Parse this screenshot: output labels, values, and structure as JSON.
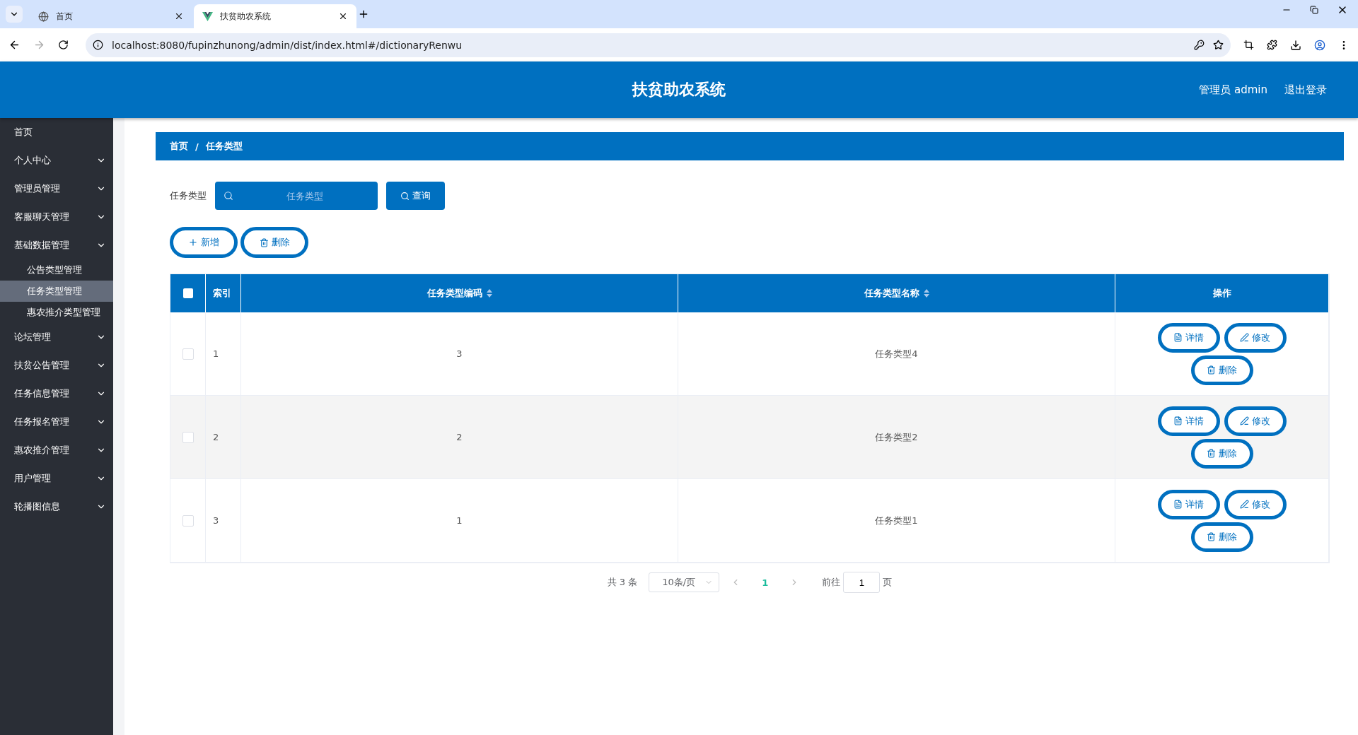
{
  "browser": {
    "tabs": [
      {
        "title": "首页",
        "selected": false
      },
      {
        "title": "扶贫助农系统",
        "selected": true
      }
    ],
    "url": "localhost:8080/fupinzhunong/admin/dist/index.html#/dictionaryRenwu"
  },
  "header": {
    "title": "扶贫助农系统",
    "user": "管理员 admin",
    "logout": "退出登录"
  },
  "sidebar": {
    "items": [
      {
        "label": "首页",
        "expandable": false,
        "selected": false
      },
      {
        "label": "个人中心",
        "expandable": true,
        "selected": false
      },
      {
        "label": "管理员管理",
        "expandable": true,
        "selected": false
      },
      {
        "label": "客服聊天管理",
        "expandable": true,
        "selected": false
      },
      {
        "label": "基础数据管理",
        "expandable": true,
        "selected": false,
        "children": [
          {
            "label": "公告类型管理",
            "selected": false
          },
          {
            "label": "任务类型管理",
            "selected": true
          },
          {
            "label": "惠农推介类型管理",
            "selected": false
          }
        ]
      },
      {
        "label": "论坛管理",
        "expandable": true,
        "selected": false
      },
      {
        "label": "扶贫公告管理",
        "expandable": true,
        "selected": false
      },
      {
        "label": "任务信息管理",
        "expandable": true,
        "selected": false
      },
      {
        "label": "任务报名管理",
        "expandable": true,
        "selected": false
      },
      {
        "label": "惠农推介管理",
        "expandable": true,
        "selected": false
      },
      {
        "label": "用户管理",
        "expandable": true,
        "selected": false
      },
      {
        "label": "轮播图信息",
        "expandable": true,
        "selected": false
      }
    ]
  },
  "breadcrumb": {
    "items": [
      "首页",
      "任务类型"
    ],
    "separator": "/"
  },
  "search": {
    "label": "任务类型",
    "placeholder": "任务类型",
    "button": "查询"
  },
  "actions": [
    "新增",
    "删除"
  ],
  "table": {
    "columns": [
      {
        "label": "索引",
        "sortable": false
      },
      {
        "label": "任务类型编码",
        "sortable": true
      },
      {
        "label": "任务类型名称",
        "sortable": true
      },
      {
        "label": "操作",
        "sortable": false
      }
    ],
    "select_all_checked": false,
    "rows": [
      {
        "index": "1",
        "code": "3",
        "name": "任务类型4",
        "checked": false,
        "actions": [
          "详情",
          "修改",
          "删除"
        ]
      },
      {
        "index": "2",
        "code": "2",
        "name": "任务类型2",
        "checked": false,
        "actions": [
          "详情",
          "修改",
          "删除"
        ]
      },
      {
        "index": "3",
        "code": "1",
        "name": "任务类型1",
        "checked": false,
        "actions": [
          "详情",
          "修改",
          "删除"
        ]
      }
    ]
  },
  "pagination": {
    "total": "共 3 条",
    "page_size": "10条/页",
    "pages": [
      {
        "label": "1",
        "selected": true
      }
    ],
    "goto_label": "前往",
    "goto_value": "1",
    "goto_suffix": "页"
  }
}
